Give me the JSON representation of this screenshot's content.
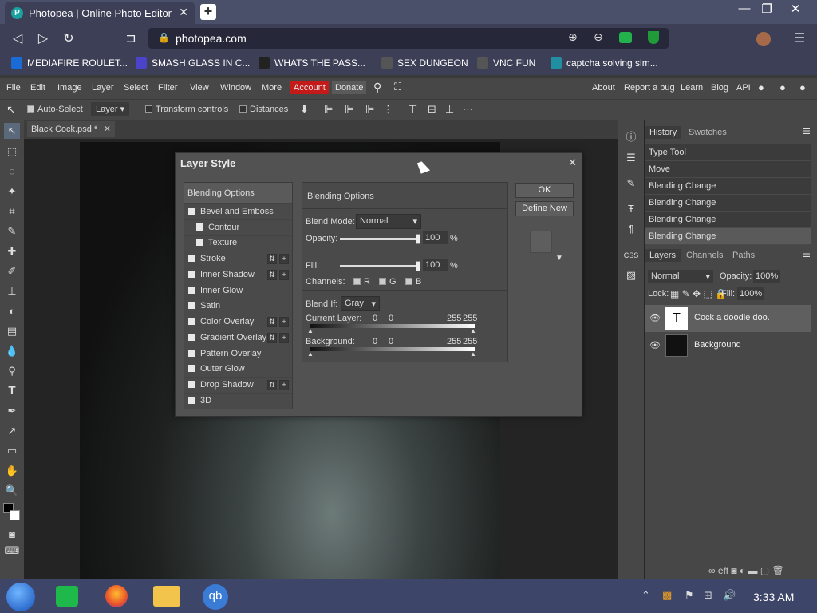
{
  "browser": {
    "tab_title": "Photopea | Online Photo Editor",
    "tab_icon": "P",
    "url": "photopea.com",
    "bookmarks": [
      {
        "label": "MEDIAFIRE ROULET...",
        "color": "#1b6bd6"
      },
      {
        "label": "SMASH GLASS IN C...",
        "color": "#4b43c9"
      },
      {
        "label": "WHATS THE PASS...",
        "color": "#222222"
      },
      {
        "label": "SEX DUNGEON",
        "color": "#555555"
      },
      {
        "label": "VNC FUN",
        "color": "#555555"
      },
      {
        "label": "captcha solving sim...",
        "color": "#1f8fa1"
      }
    ]
  },
  "menu": {
    "items": [
      "File",
      "Edit",
      "Image",
      "Layer",
      "Select",
      "Filter",
      "View",
      "Window",
      "More"
    ],
    "account": "Account",
    "donate": "Donate",
    "right_links": [
      "About",
      "Report a bug",
      "Learn",
      "Blog",
      "API"
    ]
  },
  "options": {
    "auto_select": "Auto-Select",
    "target": "Layer",
    "transform_controls": "Transform controls",
    "distances": "Distances"
  },
  "document": {
    "tab": "Black Cock.psd *"
  },
  "history": {
    "tabs": [
      "History",
      "Swatches"
    ],
    "items": [
      "Type Tool",
      "Move",
      "Blending Change",
      "Blending Change",
      "Blending Change",
      "Blending Change"
    ]
  },
  "layers": {
    "tabs": [
      "Layers",
      "Channels",
      "Paths"
    ],
    "blend_mode": "Normal",
    "opacity_label": "Opacity:",
    "opacity": "100%",
    "lock_label": "Lock:",
    "fill_label": "Fill:",
    "fill": "100%",
    "rows": [
      {
        "name": "Cock a doodle doo.",
        "thumb": "T"
      },
      {
        "name": "Background",
        "thumb": ""
      }
    ]
  },
  "dialog": {
    "title": "Layer Style",
    "styles": [
      {
        "label": "Blending Options",
        "has_box": false,
        "indent": false,
        "pm": false
      },
      {
        "label": "Bevel and Emboss",
        "has_box": true,
        "indent": false,
        "pm": false
      },
      {
        "label": "Contour",
        "has_box": true,
        "indent": true,
        "pm": false
      },
      {
        "label": "Texture",
        "has_box": true,
        "indent": true,
        "pm": false
      },
      {
        "label": "Stroke",
        "has_box": true,
        "indent": false,
        "pm": true
      },
      {
        "label": "Inner Shadow",
        "has_box": true,
        "indent": false,
        "pm": true
      },
      {
        "label": "Inner Glow",
        "has_box": true,
        "indent": false,
        "pm": false
      },
      {
        "label": "Satin",
        "has_box": true,
        "indent": false,
        "pm": false
      },
      {
        "label": "Color Overlay",
        "has_box": true,
        "indent": false,
        "pm": true
      },
      {
        "label": "Gradient Overlay",
        "has_box": true,
        "indent": false,
        "pm": true
      },
      {
        "label": "Pattern Overlay",
        "has_box": true,
        "indent": false,
        "pm": false
      },
      {
        "label": "Outer Glow",
        "has_box": true,
        "indent": false,
        "pm": false
      },
      {
        "label": "Drop Shadow",
        "has_box": true,
        "indent": false,
        "pm": true
      },
      {
        "label": "3D",
        "has_box": true,
        "indent": false,
        "pm": false
      }
    ],
    "section_title": "Blending Options",
    "blend_mode_label": "Blend Mode:",
    "blend_mode": "Normal",
    "opacity_label": "Opacity:",
    "opacity": "100",
    "percent": "%",
    "fill_label": "Fill:",
    "fill": "100",
    "channels_label": "Channels:",
    "channels": [
      "R",
      "G",
      "B"
    ],
    "blend_if_label": "Blend If:",
    "blend_if": "Gray",
    "current_layer_label": "Current Layer:",
    "current_layer_values": [
      "0",
      "0",
      "255",
      "255"
    ],
    "background_label": "Background:",
    "background_values": [
      "0",
      "0",
      "255",
      "255"
    ],
    "ok": "OK",
    "define_new": "Define New"
  },
  "taskbar": {
    "time": "3:33 AM"
  }
}
